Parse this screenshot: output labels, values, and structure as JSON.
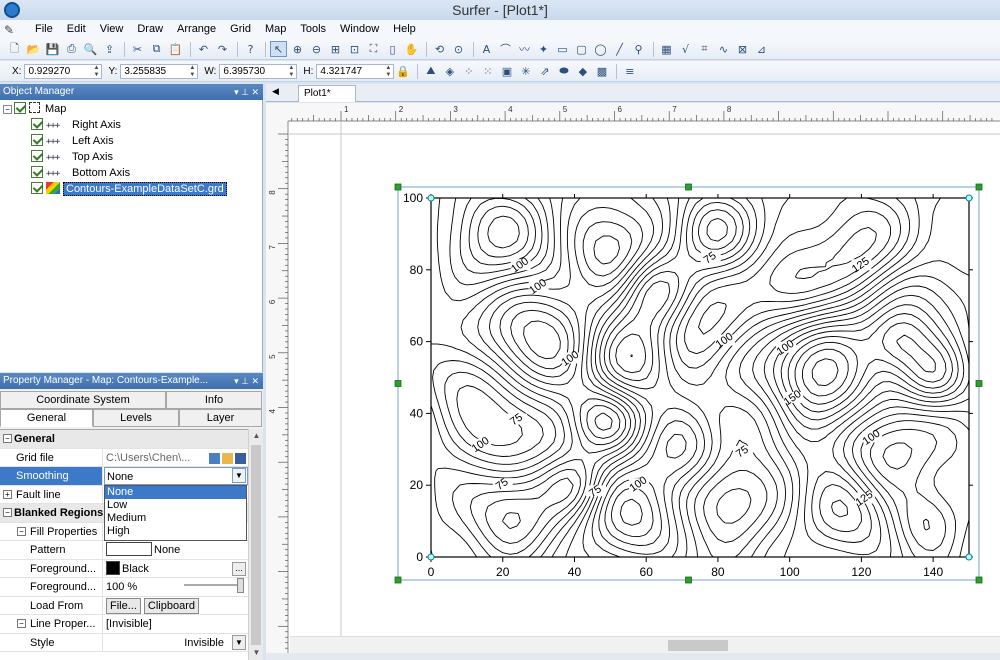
{
  "window": {
    "title": "Surfer - [Plot1*]"
  },
  "menu": [
    "File",
    "Edit",
    "View",
    "Draw",
    "Arrange",
    "Grid",
    "Map",
    "Tools",
    "Window",
    "Help"
  ],
  "coords": [
    {
      "label": "X:",
      "value": "0.929270"
    },
    {
      "label": "Y:",
      "value": "3.255835"
    },
    {
      "label": "W:",
      "value": "6.395730"
    },
    {
      "label": "H:",
      "value": "4.321747"
    }
  ],
  "object_manager": {
    "title": "Object Manager",
    "controls": "▾ ⊥ ✕",
    "map_label": "Map",
    "items": [
      "Right Axis",
      "Left Axis",
      "Top Axis",
      "Bottom Axis"
    ],
    "contour_layer": "Contours-ExampleDataSetC.grd"
  },
  "property_manager": {
    "title": "Property Manager - Map: Contours-Example...",
    "controls": "▾ ⊥ ✕",
    "tabs_top": [
      "Coordinate System",
      "Info"
    ],
    "tabs_bottom": [
      "General",
      "Levels",
      "Layer"
    ],
    "rows": {
      "general_section": "General",
      "grid_file": {
        "name": "Grid file",
        "value": "C:\\Users\\Chen\\..."
      },
      "smoothing": {
        "name": "Smoothing",
        "value": "None"
      },
      "fault_line": {
        "name": "Fault line"
      },
      "blanked_regions": "Blanked Regions",
      "fill_properties": "Fill Properties",
      "pattern": {
        "name": "Pattern",
        "value": "None"
      },
      "foreground": {
        "name": "Foreground...",
        "value": "Black"
      },
      "foreground_opacity": {
        "name": "Foreground...",
        "value": "100 %"
      },
      "load_from": {
        "name": "Load From",
        "file_btn": "File...",
        "clipboard_btn": "Clipboard"
      },
      "line_properties": {
        "name": "Line Proper...",
        "value": "[Invisible]"
      },
      "style": {
        "name": "Style",
        "value": "Invisible"
      }
    },
    "smoothing_options": [
      "None",
      "Low",
      "Medium",
      "High"
    ],
    "smoothing_selected": "None"
  },
  "document": {
    "tab": "Plot1*"
  },
  "ruler": {
    "top_labels": [
      "1",
      "2",
      "3",
      "4",
      "5",
      "6",
      "7",
      "8"
    ],
    "left_labels": [
      "8",
      "7",
      "6",
      "5",
      "4"
    ]
  },
  "chart_data": {
    "type": "contour",
    "title": "",
    "xlabel": "",
    "ylabel": "",
    "xlim": [
      0,
      150
    ],
    "ylim": [
      0,
      100
    ],
    "x_ticks": [
      0,
      20,
      40,
      60,
      80,
      100,
      120,
      140
    ],
    "y_ticks": [
      0,
      20,
      40,
      60,
      80,
      100
    ],
    "contour_labels": [
      {
        "text": "100",
        "x": 25,
        "y": 81
      },
      {
        "text": "100",
        "x": 30,
        "y": 75
      },
      {
        "text": "75",
        "x": 78,
        "y": 83
      },
      {
        "text": "125",
        "x": 120,
        "y": 81
      },
      {
        "text": "100",
        "x": 39,
        "y": 55
      },
      {
        "text": "100",
        "x": 82,
        "y": 60
      },
      {
        "text": "100",
        "x": 99,
        "y": 58
      },
      {
        "text": "75",
        "x": 24,
        "y": 38
      },
      {
        "text": "150",
        "x": 101,
        "y": 44
      },
      {
        "text": "100",
        "x": 14,
        "y": 31
      },
      {
        "text": "100",
        "x": 123,
        "y": 33
      },
      {
        "text": "75",
        "x": 87,
        "y": 29
      },
      {
        "text": "75",
        "x": 20,
        "y": 20
      },
      {
        "text": "100",
        "x": 58,
        "y": 20
      },
      {
        "text": "75",
        "x": 46,
        "y": 18
      },
      {
        "text": "125",
        "x": 121,
        "y": 16
      }
    ],
    "line_color": "#000000"
  },
  "colors": {
    "selection": "#3c79c9",
    "handle": "#2aa02a",
    "accent": "#3f6fae"
  }
}
